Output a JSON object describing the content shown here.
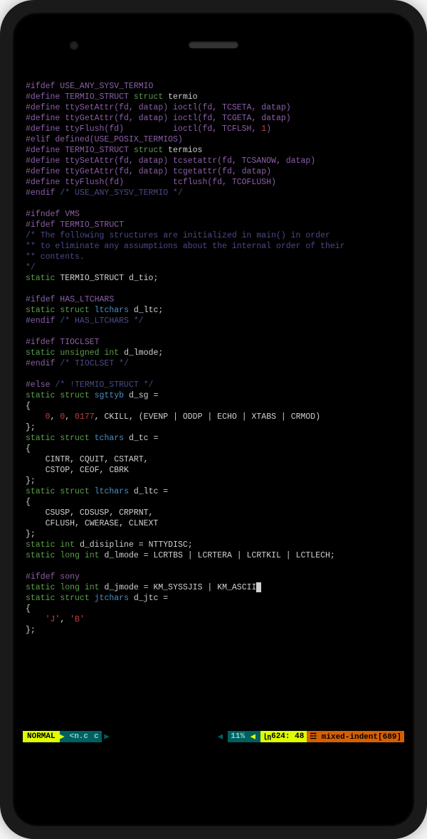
{
  "code_lines": [
    {
      "segments": [
        {
          "c": "preproc",
          "t": "#ifdef USE_ANY_SYSV_TERMIO"
        }
      ]
    },
    {
      "segments": [
        {
          "c": "preproc",
          "t": "#define TERMIO_STRUCT "
        },
        {
          "c": "keyword",
          "t": "struct"
        },
        {
          "c": "normal",
          "t": " termio"
        }
      ]
    },
    {
      "segments": [
        {
          "c": "preproc",
          "t": "#define ttySetAttr(fd, datap) ioctl(fd, TCSETA, datap)"
        }
      ]
    },
    {
      "segments": [
        {
          "c": "preproc",
          "t": "#define ttyGetAttr(fd, datap) ioctl(fd, TCGETA, datap)"
        }
      ]
    },
    {
      "segments": [
        {
          "c": "preproc",
          "t": "#define ttyFlush(fd)          ioctl(fd, TCFLSH, "
        },
        {
          "c": "number",
          "t": "1"
        },
        {
          "c": "preproc",
          "t": ")"
        }
      ]
    },
    {
      "segments": [
        {
          "c": "preproc",
          "t": "#elif defined(USE_POSIX_TERMIOS)"
        }
      ]
    },
    {
      "segments": [
        {
          "c": "preproc",
          "t": "#define TERMIO_STRUCT "
        },
        {
          "c": "keyword",
          "t": "struct"
        },
        {
          "c": "normal",
          "t": " termios"
        }
      ]
    },
    {
      "segments": [
        {
          "c": "preproc",
          "t": "#define ttySetAttr(fd, datap) tcsetattr(fd, TCSANOW, datap)"
        }
      ]
    },
    {
      "segments": [
        {
          "c": "preproc",
          "t": "#define ttyGetAttr(fd, datap) tcgetattr(fd, datap)"
        }
      ]
    },
    {
      "segments": [
        {
          "c": "preproc",
          "t": "#define ttyFlush(fd)          tcflush(fd, TCOFLUSH)"
        }
      ]
    },
    {
      "segments": [
        {
          "c": "preproc",
          "t": "#endif "
        },
        {
          "c": "comment",
          "t": "/* USE_ANY_SYSV_TERMIO */"
        }
      ]
    },
    {
      "segments": [
        {
          "c": "normal",
          "t": ""
        }
      ]
    },
    {
      "segments": [
        {
          "c": "preproc",
          "t": "#ifndef VMS"
        }
      ]
    },
    {
      "segments": [
        {
          "c": "preproc",
          "t": "#ifdef TERMIO_STRUCT"
        }
      ]
    },
    {
      "segments": [
        {
          "c": "comment",
          "t": "/* The following structures are initialized in main() in order"
        }
      ]
    },
    {
      "segments": [
        {
          "c": "comment",
          "t": "** to eliminate any assumptions about the internal order of their"
        }
      ]
    },
    {
      "segments": [
        {
          "c": "comment",
          "t": "** contents."
        }
      ]
    },
    {
      "segments": [
        {
          "c": "comment",
          "t": "*/"
        }
      ]
    },
    {
      "segments": [
        {
          "c": "keyword",
          "t": "static"
        },
        {
          "c": "normal",
          "t": " TERMIO_STRUCT d_tio;"
        }
      ]
    },
    {
      "segments": [
        {
          "c": "normal",
          "t": ""
        }
      ]
    },
    {
      "segments": [
        {
          "c": "preproc",
          "t": "#ifdef HAS_LTCHARS"
        }
      ]
    },
    {
      "segments": [
        {
          "c": "keyword",
          "t": "static"
        },
        {
          "c": "normal",
          "t": " "
        },
        {
          "c": "keyword",
          "t": "struct"
        },
        {
          "c": "normal",
          "t": " "
        },
        {
          "c": "ident",
          "t": "ltchars"
        },
        {
          "c": "normal",
          "t": " d_ltc;"
        }
      ]
    },
    {
      "segments": [
        {
          "c": "preproc",
          "t": "#endif "
        },
        {
          "c": "comment",
          "t": "/* HAS_LTCHARS */"
        }
      ]
    },
    {
      "segments": [
        {
          "c": "normal",
          "t": ""
        }
      ]
    },
    {
      "segments": [
        {
          "c": "preproc",
          "t": "#ifdef TIOCLSET"
        }
      ]
    },
    {
      "segments": [
        {
          "c": "keyword",
          "t": "static"
        },
        {
          "c": "normal",
          "t": " "
        },
        {
          "c": "keyword",
          "t": "unsigned"
        },
        {
          "c": "normal",
          "t": " "
        },
        {
          "c": "keyword",
          "t": "int"
        },
        {
          "c": "normal",
          "t": " d_lmode;"
        }
      ]
    },
    {
      "segments": [
        {
          "c": "preproc",
          "t": "#endif "
        },
        {
          "c": "comment",
          "t": "/* TIOCLSET */"
        }
      ]
    },
    {
      "segments": [
        {
          "c": "normal",
          "t": ""
        }
      ]
    },
    {
      "segments": [
        {
          "c": "preproc",
          "t": "#else "
        },
        {
          "c": "comment",
          "t": "/* !TERMIO_STRUCT */"
        }
      ]
    },
    {
      "segments": [
        {
          "c": "keyword",
          "t": "static"
        },
        {
          "c": "normal",
          "t": " "
        },
        {
          "c": "keyword",
          "t": "struct"
        },
        {
          "c": "normal",
          "t": " "
        },
        {
          "c": "ident",
          "t": "sgttyb"
        },
        {
          "c": "normal",
          "t": " d_sg ="
        }
      ]
    },
    {
      "segments": [
        {
          "c": "normal",
          "t": "{"
        }
      ]
    },
    {
      "segments": [
        {
          "c": "normal",
          "t": "    "
        },
        {
          "c": "number",
          "t": "0"
        },
        {
          "c": "normal",
          "t": ", "
        },
        {
          "c": "number",
          "t": "0"
        },
        {
          "c": "normal",
          "t": ", "
        },
        {
          "c": "number",
          "t": "0177"
        },
        {
          "c": "normal",
          "t": ", CKILL, (EVENP | ODDP | ECHO | XTABS | CRMOD)"
        }
      ]
    },
    {
      "segments": [
        {
          "c": "normal",
          "t": "};"
        }
      ]
    },
    {
      "segments": [
        {
          "c": "keyword",
          "t": "static"
        },
        {
          "c": "normal",
          "t": " "
        },
        {
          "c": "keyword",
          "t": "struct"
        },
        {
          "c": "normal",
          "t": " "
        },
        {
          "c": "ident",
          "t": "tchars"
        },
        {
          "c": "normal",
          "t": " d_tc ="
        }
      ]
    },
    {
      "segments": [
        {
          "c": "normal",
          "t": "{"
        }
      ]
    },
    {
      "segments": [
        {
          "c": "normal",
          "t": "    CINTR, CQUIT, CSTART,"
        }
      ]
    },
    {
      "segments": [
        {
          "c": "normal",
          "t": "    CSTOP, CEOF, CBRK"
        }
      ]
    },
    {
      "segments": [
        {
          "c": "normal",
          "t": "};"
        }
      ]
    },
    {
      "segments": [
        {
          "c": "keyword",
          "t": "static"
        },
        {
          "c": "normal",
          "t": " "
        },
        {
          "c": "keyword",
          "t": "struct"
        },
        {
          "c": "normal",
          "t": " "
        },
        {
          "c": "ident",
          "t": "ltchars"
        },
        {
          "c": "normal",
          "t": " d_ltc ="
        }
      ]
    },
    {
      "segments": [
        {
          "c": "normal",
          "t": "{"
        }
      ]
    },
    {
      "segments": [
        {
          "c": "normal",
          "t": "    CSUSP, CDSUSP, CRPRNT,"
        }
      ]
    },
    {
      "segments": [
        {
          "c": "normal",
          "t": "    CFLUSH, CWERASE, CLNEXT"
        }
      ]
    },
    {
      "segments": [
        {
          "c": "normal",
          "t": "};"
        }
      ]
    },
    {
      "segments": [
        {
          "c": "keyword",
          "t": "static"
        },
        {
          "c": "normal",
          "t": " "
        },
        {
          "c": "keyword",
          "t": "int"
        },
        {
          "c": "normal",
          "t": " d_disipline = NTTYDISC;"
        }
      ]
    },
    {
      "segments": [
        {
          "c": "keyword",
          "t": "static"
        },
        {
          "c": "normal",
          "t": " "
        },
        {
          "c": "keyword",
          "t": "long"
        },
        {
          "c": "normal",
          "t": " "
        },
        {
          "c": "keyword",
          "t": "int"
        },
        {
          "c": "normal",
          "t": " d_lmode = LCRTBS | LCRTERA | LCRTKIL | LCTLECH;"
        }
      ]
    },
    {
      "segments": [
        {
          "c": "normal",
          "t": ""
        }
      ]
    },
    {
      "segments": [
        {
          "c": "preproc",
          "t": "#ifdef sony"
        }
      ]
    },
    {
      "segments": [
        {
          "c": "keyword",
          "t": "static"
        },
        {
          "c": "normal",
          "t": " "
        },
        {
          "c": "keyword",
          "t": "long"
        },
        {
          "c": "normal",
          "t": " "
        },
        {
          "c": "keyword",
          "t": "int"
        },
        {
          "c": "normal",
          "t": " d_jmode = KM_SYSSJIS | KM_ASCII"
        },
        {
          "c": "cursor",
          "t": ";"
        }
      ]
    },
    {
      "segments": [
        {
          "c": "keyword",
          "t": "static"
        },
        {
          "c": "normal",
          "t": " "
        },
        {
          "c": "keyword",
          "t": "struct"
        },
        {
          "c": "normal",
          "t": " "
        },
        {
          "c": "ident",
          "t": "jtchars"
        },
        {
          "c": "normal",
          "t": " d_jtc ="
        }
      ]
    },
    {
      "segments": [
        {
          "c": "normal",
          "t": "{"
        }
      ]
    },
    {
      "segments": [
        {
          "c": "normal",
          "t": "    "
        },
        {
          "c": "string",
          "t": "'J'"
        },
        {
          "c": "normal",
          "t": ", "
        },
        {
          "c": "string",
          "t": "'B'"
        }
      ]
    },
    {
      "segments": [
        {
          "c": "normal",
          "t": "};"
        }
      ]
    }
  ],
  "status": {
    "mode": " NORMAL ",
    "file": " <n.c ",
    "filetype": " c ",
    "percent": " 11% ",
    "lineno_label": "㏑",
    "position": " 624: 48 ",
    "warning": " ☲ mixed-indent[689]"
  }
}
